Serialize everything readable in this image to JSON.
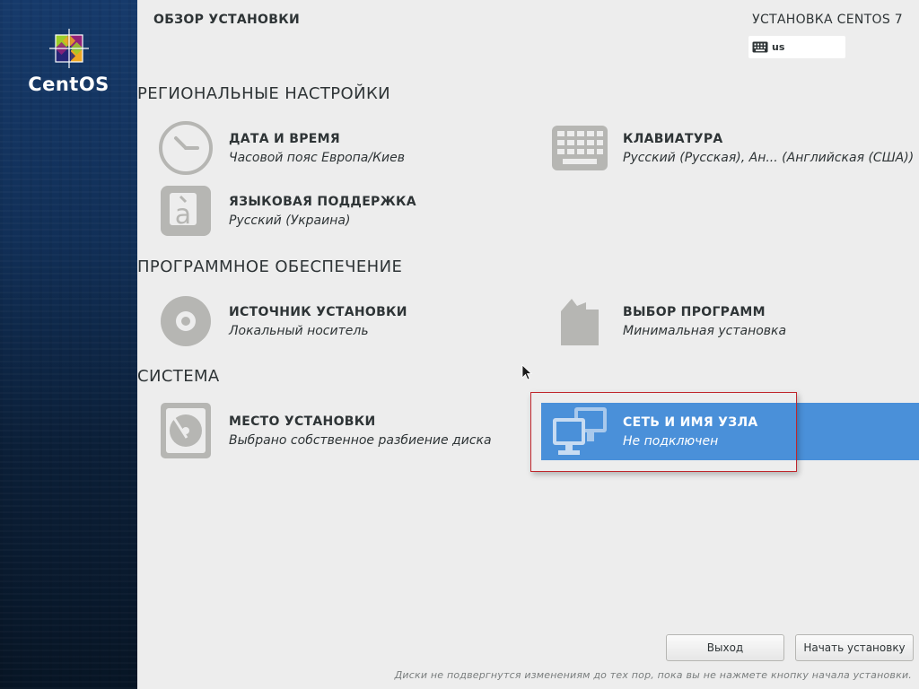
{
  "sidebar": {
    "logo_text": "CentOS"
  },
  "header": {
    "title": "ОБЗОР УСТАНОВКИ",
    "product": "УСТАНОВКА CENTOS 7",
    "keyboard_layout": "us",
    "keyboard_icon": "keyboard-icon"
  },
  "sections": {
    "localization": {
      "heading": "РЕГИОНАЛЬНЫЕ НАСТРОЙКИ",
      "spokes": {
        "datetime": {
          "title": "ДАТА И ВРЕМЯ",
          "status": "Часовой пояс Европа/Киев",
          "icon": "clock-icon"
        },
        "keyboard": {
          "title": "КЛАВИАТУРА",
          "status": "Русский (Русская), Ан... (Английская (США))",
          "icon": "keyboard-icon"
        },
        "language": {
          "title": "ЯЗЫКОВАЯ ПОДДЕРЖКА",
          "status": "Русский (Украина)",
          "icon": "language-icon"
        }
      }
    },
    "software": {
      "heading": "ПРОГРАММНОЕ ОБЕСПЕЧЕНИЕ",
      "spokes": {
        "source": {
          "title": "ИСТОЧНИК УСТАНОВКИ",
          "status": "Локальный носитель",
          "icon": "disc-icon"
        },
        "selection": {
          "title": "ВЫБОР ПРОГРАММ",
          "status": "Минимальная установка",
          "icon": "package-icon"
        }
      }
    },
    "system": {
      "heading": "СИСТЕМА",
      "spokes": {
        "destination": {
          "title": "МЕСТО УСТАНОВКИ",
          "status": "Выбрано собственное разбиение диска",
          "icon": "harddisk-icon"
        },
        "network": {
          "title": "СЕТЬ И ИМЯ УЗЛА",
          "status": "Не подключен",
          "icon": "network-icon",
          "selected": true
        }
      }
    }
  },
  "buttons": {
    "quit": "Выход",
    "begin": "Начать установку"
  },
  "footer": {
    "note": "Диски не подвергнутся изменениям до тех пор, пока вы не нажмете кнопку начала установки."
  },
  "colors": {
    "accent_selected": "#4a90d9",
    "highlight_border": "#c0262b",
    "sidebar_top": "#163a6b",
    "sidebar_bottom": "#071525",
    "background": "#ededed"
  }
}
